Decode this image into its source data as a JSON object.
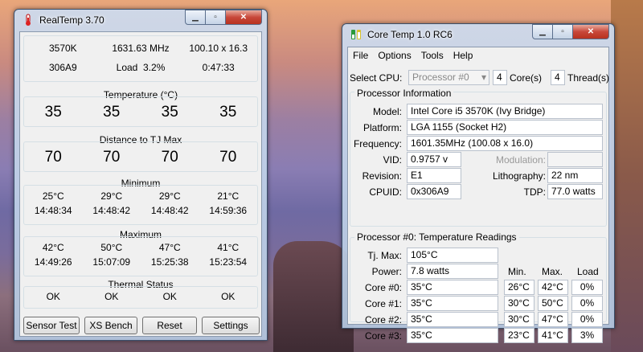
{
  "realtemp": {
    "title": "RealTemp 3.70",
    "info": {
      "cpu": "3570K",
      "mhz": "1631.63 MHz",
      "multiplier": "100.10 x 16.3",
      "cpuid": "306A9",
      "load_label": "Load",
      "load_value": "3.2%",
      "uptime": "0:47:33"
    },
    "temperature_heading": "Temperature (°C)",
    "temperatures": [
      "35",
      "35",
      "35",
      "35"
    ],
    "distance_heading": "Distance to TJ Max",
    "distances": [
      "70",
      "70",
      "70",
      "70"
    ],
    "minimum_heading": "Minimum",
    "minimum": [
      {
        "temp": "25°C",
        "time": "14:48:34"
      },
      {
        "temp": "29°C",
        "time": "14:48:42"
      },
      {
        "temp": "29°C",
        "time": "14:48:42"
      },
      {
        "temp": "21°C",
        "time": "14:59:36"
      }
    ],
    "maximum_heading": "Maximum",
    "maximum": [
      {
        "temp": "42°C",
        "time": "14:49:26"
      },
      {
        "temp": "50°C",
        "time": "15:07:09"
      },
      {
        "temp": "47°C",
        "time": "15:25:38"
      },
      {
        "temp": "41°C",
        "time": "15:23:54"
      }
    ],
    "thermal_heading": "Thermal Status",
    "thermal": [
      "OK",
      "OK",
      "OK",
      "OK"
    ],
    "buttons": {
      "sensor_test": "Sensor Test",
      "xs_bench": "XS Bench",
      "reset": "Reset",
      "settings": "Settings"
    }
  },
  "coretemp": {
    "title": "Core Temp 1.0 RC6",
    "menu": [
      "File",
      "Options",
      "Tools",
      "Help"
    ],
    "select_cpu_label": "Select CPU:",
    "select_cpu_value": "Processor #0",
    "cores_count": "4",
    "cores_label": "Core(s)",
    "threads_count": "4",
    "threads_label": "Thread(s)",
    "processor_info_heading": "Processor Information",
    "model_label": "Model:",
    "model_value": "Intel Core i5 3570K (Ivy Bridge)",
    "platform_label": "Platform:",
    "platform_value": "LGA 1155 (Socket H2)",
    "frequency_label": "Frequency:",
    "frequency_value": "1601.35MHz (100.08 x 16.0)",
    "vid_label": "VID:",
    "vid_value": "0.9757 v",
    "modulation_label": "Modulation:",
    "modulation_value": "",
    "revision_label": "Revision:",
    "revision_value": "E1",
    "lithography_label": "Lithography:",
    "lithography_value": "22 nm",
    "cpuid_label": "CPUID:",
    "cpuid_value": "0x306A9",
    "tdp_label": "TDP:",
    "tdp_value": "77.0 watts",
    "readings_heading": "Processor #0: Temperature Readings",
    "tjmax_label": "Tj. Max:",
    "tjmax_value": "105°C",
    "power_label": "Power:",
    "power_value": "7.8 watts",
    "col_min": "Min.",
    "col_max": "Max.",
    "col_load": "Load",
    "cores": [
      {
        "label": "Core #0:",
        "temp": "35°C",
        "min": "26°C",
        "max": "42°C",
        "load": "0%"
      },
      {
        "label": "Core #1:",
        "temp": "35°C",
        "min": "30°C",
        "max": "50°C",
        "load": "0%"
      },
      {
        "label": "Core #2:",
        "temp": "35°C",
        "min": "30°C",
        "max": "47°C",
        "load": "0%"
      },
      {
        "label": "Core #3:",
        "temp": "35°C",
        "min": "23°C",
        "max": "41°C",
        "load": "3%"
      }
    ]
  }
}
